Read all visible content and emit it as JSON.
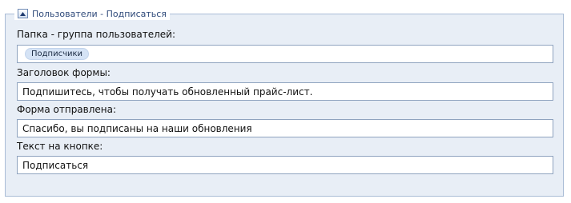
{
  "panel": {
    "legend": "Пользователи - Подписаться"
  },
  "fields": {
    "group": {
      "label": "Папка - группа пользователей:",
      "tag": "Подписчики"
    },
    "form_title": {
      "label": "Заголовок формы:",
      "value": "Подпишитесь, чтобы получать обновленный прайс-лист."
    },
    "form_sent": {
      "label": "Форма отправлена:",
      "value": "Спасибо, вы подписаны на наши обновления"
    },
    "button_text": {
      "label": "Текст на кнопке:",
      "value": "Подписаться"
    }
  },
  "icons": {
    "collapse": "collapse-up-arrow-icon"
  },
  "colors": {
    "panel_background": "#e8eef6",
    "panel_border": "#a9bcd6",
    "legend_text": "#2f4a7a",
    "tag_background": "#d5e3f5"
  }
}
